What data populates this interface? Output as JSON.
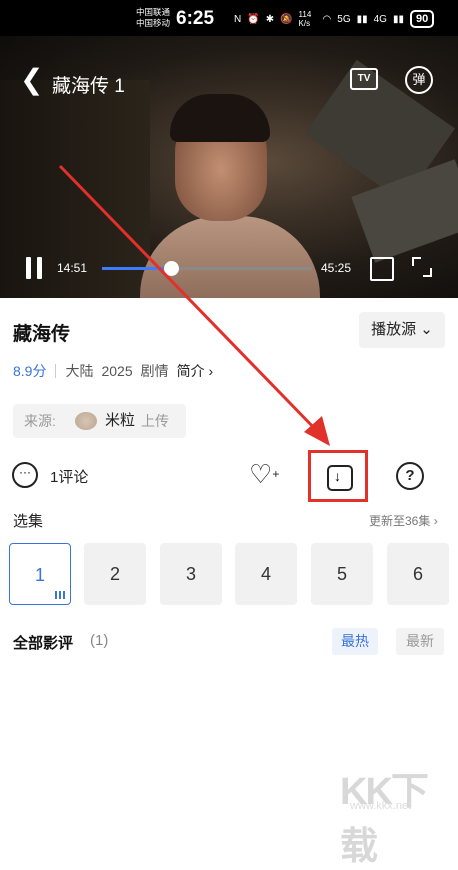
{
  "status_bar": {
    "carrier1": "中国联通",
    "carrier2": "中国移动",
    "time": "6:25",
    "net_speed": "114 K/s",
    "sig1": "5G",
    "sig2": "4G",
    "battery": "90"
  },
  "player": {
    "title": "藏海传 1",
    "tv_label": "TV",
    "danmu_label": "弹",
    "current_time": "14:51",
    "total_time": "45:25",
    "progress": 0.33
  },
  "show": {
    "title": "藏海传",
    "source_button": "播放源",
    "score": "8.9分",
    "region": "大陆",
    "year": "2025",
    "genre": "剧情",
    "intro_link": "简介",
    "source_label": "来源:",
    "uploader_name": "米粒",
    "uploader_suffix": "上传"
  },
  "actions": {
    "comment_label": "1评论"
  },
  "episodes": {
    "title": "选集",
    "more": "更新至36集",
    "items": [
      "1",
      "2",
      "3",
      "4",
      "5",
      "6"
    ],
    "selected": "1"
  },
  "reviews": {
    "title": "全部影评",
    "count": "(1)",
    "sort_hot": "最热",
    "sort_new": "最新"
  },
  "watermark": {
    "logo": "KK下载",
    "url": "www.kkx.net"
  },
  "colors": {
    "accent": "#3a74d6",
    "highlight": "#e2302b"
  }
}
